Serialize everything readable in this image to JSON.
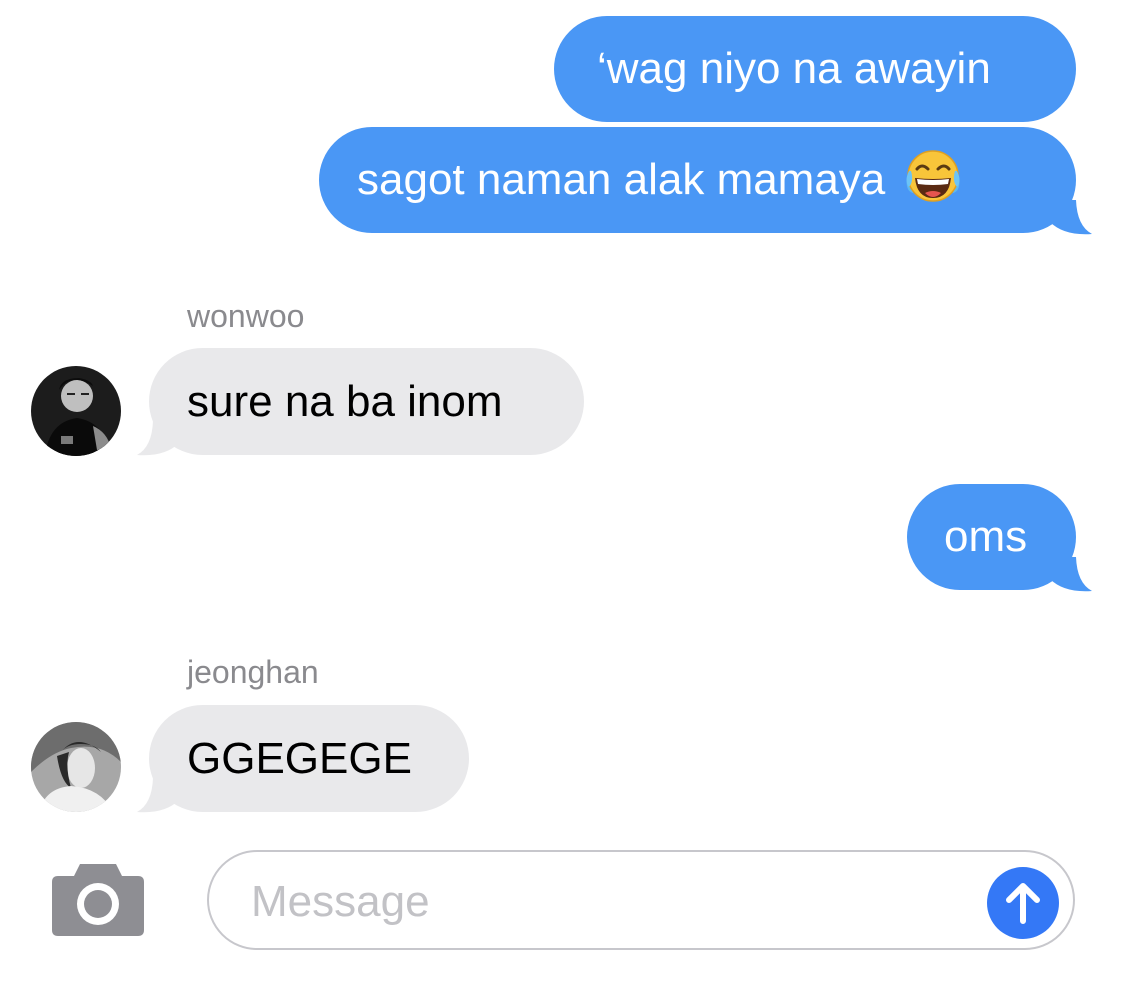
{
  "conversation": {
    "messages": [
      {
        "direction": "outgoing",
        "text": "‘wag niyo na awayin"
      },
      {
        "direction": "outgoing",
        "text": "sagot naman alak mamaya",
        "emoji": "face-with-tears-of-joy-icon"
      },
      {
        "direction": "incoming",
        "sender": "wonwoo",
        "text": "sure na ba inom"
      },
      {
        "direction": "outgoing",
        "text": "oms"
      },
      {
        "direction": "incoming",
        "sender": "jeonghan",
        "text": "GGEGEGE"
      }
    ]
  },
  "composer": {
    "placeholder": "Message",
    "value": "",
    "camera_icon": "camera-icon",
    "send_icon": "arrow-up-icon"
  },
  "colors": {
    "outgoing_bubble": "#4a97f5",
    "incoming_bubble": "#e9e9eb",
    "send_button": "#3478f6",
    "sender_name": "#8a8a8e",
    "camera": "#8e8e93"
  }
}
